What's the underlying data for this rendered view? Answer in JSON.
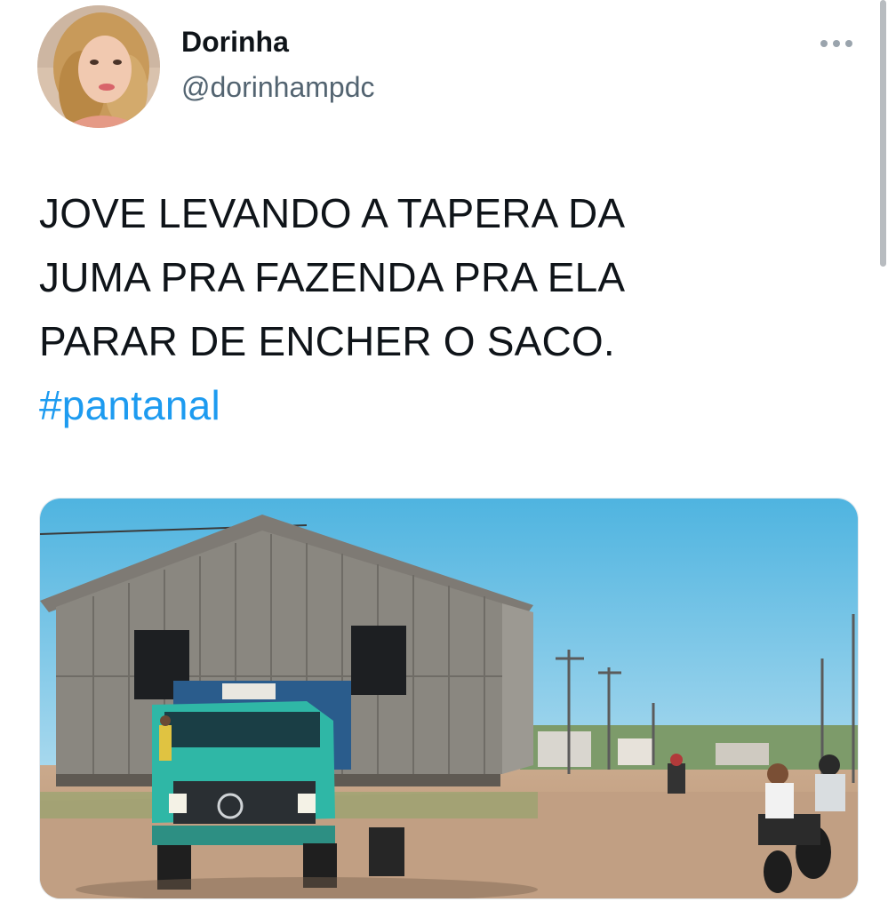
{
  "user": {
    "display_name": "Dorinha",
    "handle": "@dorinhampdc",
    "avatar_icon": "profile-photo"
  },
  "more_icon": "ellipsis-icon",
  "tweet": {
    "lines": [
      "JOVE LEVANDO A TAPERA DA",
      "JUMA PRA FAZENDA PRA ELA",
      "PARAR DE ENCHER O SACO."
    ],
    "hashtag": "#pantanal"
  },
  "colors": {
    "text": "#0f1419",
    "secondary": "#536471",
    "link": "#1d9bf0"
  }
}
